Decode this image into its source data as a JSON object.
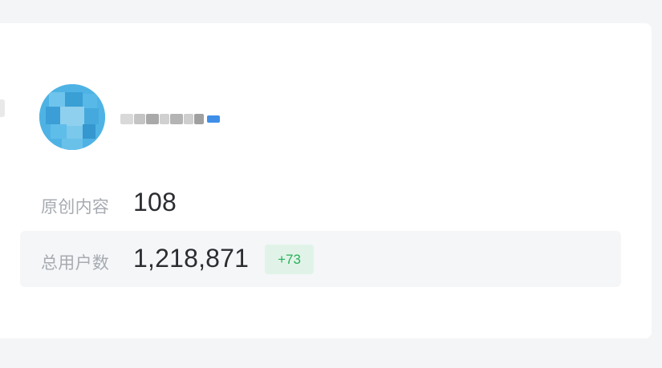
{
  "profile": {
    "avatar_icon": "avatar-icon",
    "username": "",
    "verified_badge_icon": "verified-badge-icon",
    "accent": "#47aee0"
  },
  "stats": {
    "original_content": {
      "label": "原创内容",
      "value": "108"
    },
    "total_users": {
      "label": "总用户数",
      "value": "1,218,871",
      "delta": "+73",
      "delta_color": "#27b15a"
    }
  }
}
